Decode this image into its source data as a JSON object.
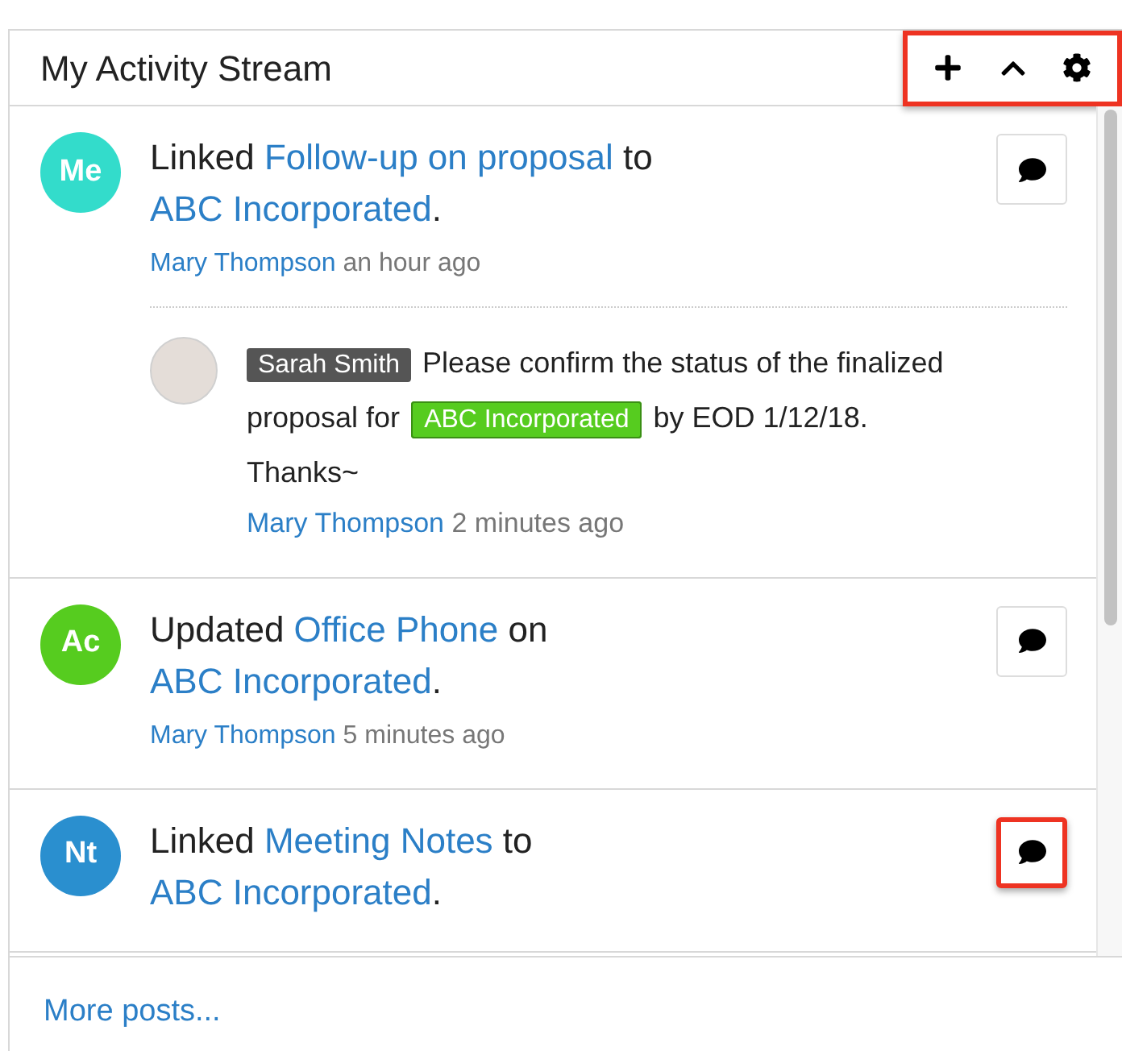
{
  "panel": {
    "title": "My Activity Stream",
    "toolbar_highlighted": true
  },
  "posts": [
    {
      "initials": "Me",
      "color": "#33dccb",
      "message": [
        {
          "kind": "text",
          "text": "Linked "
        },
        {
          "kind": "link",
          "text": "Follow-up on proposal"
        },
        {
          "kind": "text",
          "text": " to "
        },
        {
          "kind": "link",
          "text": "ABC Incorporated"
        },
        {
          "kind": "text",
          "text": "."
        }
      ],
      "author": "Mary Thompson",
      "time": "an hour ago",
      "comment_highlighted": false,
      "replies": [
        {
          "message": [
            {
              "kind": "mention",
              "text": "Sarah Smith"
            },
            {
              "kind": "text",
              "text": " Please confirm the status of the finalized proposal for "
            },
            {
              "kind": "record",
              "text": "ABC Incorporated"
            },
            {
              "kind": "text",
              "text": " by EOD 1/12/18. Thanks~"
            }
          ],
          "author": "Mary Thompson",
          "time": "2 minutes ago"
        }
      ]
    },
    {
      "initials": "Ac",
      "color": "#56cc1f",
      "message": [
        {
          "kind": "text",
          "text": "Updated "
        },
        {
          "kind": "link",
          "text": "Office Phone"
        },
        {
          "kind": "text",
          "text": " on "
        },
        {
          "kind": "link",
          "text": "ABC Incorporated"
        },
        {
          "kind": "text",
          "text": "."
        }
      ],
      "author": "Mary Thompson",
      "time": "5 minutes ago",
      "comment_highlighted": false
    },
    {
      "initials": "Nt",
      "color": "#2a8fcf",
      "message": [
        {
          "kind": "text",
          "text": "Linked "
        },
        {
          "kind": "link",
          "text": "Meeting Notes"
        },
        {
          "kind": "text",
          "text": " to "
        },
        {
          "kind": "link",
          "text": "ABC Incorporated"
        },
        {
          "kind": "text",
          "text": "."
        }
      ],
      "comment_highlighted": true
    }
  ],
  "footer": {
    "link": "More posts..."
  }
}
